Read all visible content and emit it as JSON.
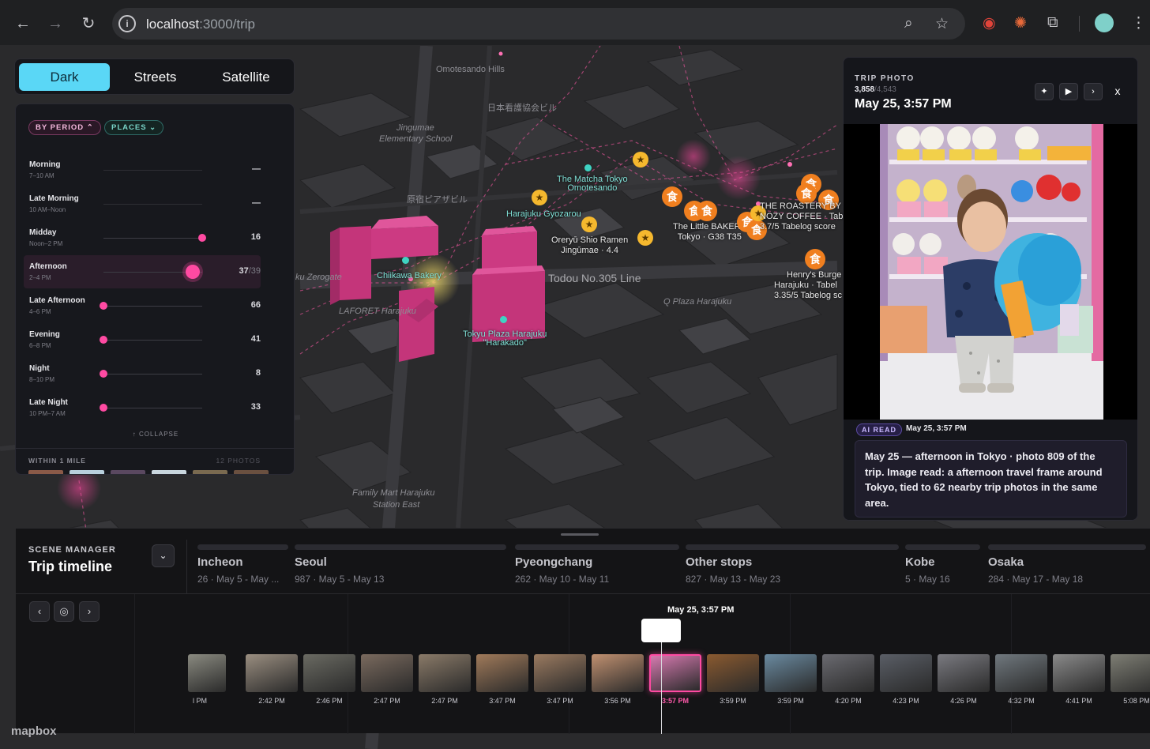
{
  "browser": {
    "url_host": "localhost",
    "url_path": ":3000/trip"
  },
  "map_style": {
    "options": [
      "Dark",
      "Streets",
      "Satellite"
    ],
    "active": "Dark"
  },
  "map_labels": {
    "omotesando_hills": "Omotesando Hills",
    "nihon_kango": "日本看護協会ビル",
    "jingumae_school_1": "Jingumae",
    "jingumae_school_2": "Elementary School",
    "harajuku_piazza": "原宿ピアザビル",
    "zerogate": "ku Zerogate",
    "laforet": "LAFORET Harajuku",
    "todou_line": "Todou No.305 Line",
    "q_plaza": "Q Plaza Harajuku",
    "family_mart_1": "Family Mart Harajuku",
    "family_mart_2": "Station East"
  },
  "pois": {
    "matcha": [
      "The Matcha Tokyo",
      "Omotesando"
    ],
    "gyozarou": "Harajuku Gyozarou",
    "chiikawa": "Chiikawa Bakery",
    "tokyu": [
      "Tokyu Plaza Harajuku",
      "\"Harakado\""
    ],
    "oreryu": [
      "Oreryū Shio Ramen",
      "Jingūmae · 4.4"
    ],
    "little_bakery": [
      "The Little BAKERY",
      "Tokyo · G38 T35"
    ],
    "roastery": [
      "THE ROASTERY BY",
      "NOZY COFFEE · Tabel",
      "3.7/5 Tabelog score"
    ],
    "henrys": [
      "Henry's Burge",
      "Harajuku · Tabel",
      "3.35/5 Tabelog sc"
    ]
  },
  "food_glyph": "食",
  "star_glyph": "★",
  "period_panel": {
    "chip_period": "BY PERIOD ⌃",
    "chip_places": "PLACES ⌄",
    "rows": [
      {
        "name": "Morning",
        "time": "7–10 AM",
        "count": "—",
        "level": null
      },
      {
        "name": "Late Morning",
        "time": "10 AM–Noon",
        "count": "—",
        "level": null
      },
      {
        "name": "Midday",
        "time": "Noon–2 PM",
        "count": "16",
        "level": 1.0
      },
      {
        "name": "Afternoon",
        "time": "2–4 PM",
        "count": "37",
        "of": "/39",
        "level": 0.9,
        "selected": true
      },
      {
        "name": "Late Afternoon",
        "time": "4–6 PM",
        "count": "66",
        "level": 0.0
      },
      {
        "name": "Evening",
        "time": "6–8 PM",
        "count": "41",
        "level": 0.0
      },
      {
        "name": "Night",
        "time": "8–10 PM",
        "count": "8",
        "level": 0.0
      },
      {
        "name": "Late Night",
        "time": "10 PM–7 AM",
        "count": "33",
        "level": 0.0
      }
    ],
    "collapse": "↑ COLLAPSE",
    "within": "WITHIN 1 MILE",
    "photos": "12 PHOTOS"
  },
  "trip_photo": {
    "label": "TRIP PHOTO",
    "index": "3,858",
    "total": "/4,543",
    "date": "May 25, 3:57 PM",
    "ai_badge": "AI READ",
    "ai_date": "May 25, 3:57 PM",
    "ai_text": "May 25 — afternoon in Tokyo · photo 809 of the trip. Image read: a afternoon travel frame around Tokyo, tied to 62 nearby trip photos in the same area."
  },
  "timeline": {
    "label": "SCENE MANAGER",
    "title": "Trip timeline",
    "cursor_label": "May 25, 3:57 PM",
    "cities": [
      {
        "name": "Incheon",
        "detail": "26 · May 5 - May ..."
      },
      {
        "name": "Seoul",
        "detail": "987 · May 5 - May 13"
      },
      {
        "name": "Pyeongchang",
        "detail": "262 · May 10 - May 11"
      },
      {
        "name": "Other stops",
        "detail": "827 · May 13 - May 23"
      },
      {
        "name": "Kobe",
        "detail": "5 · May 16"
      },
      {
        "name": "Osaka",
        "detail": "284 · May 17 - May 18"
      }
    ],
    "thumbs": [
      "l PM",
      "2:42 PM",
      "2:46 PM",
      "2:47 PM",
      "2:47 PM",
      "3:47 PM",
      "3:47 PM",
      "3:56 PM",
      "3:57 PM",
      "3:59 PM",
      "3:59 PM",
      "4:20 PM",
      "4:23 PM",
      "4:26 PM",
      "4:32 PM",
      "4:41 PM",
      "5:08 PM"
    ],
    "selected_thumb": 8
  },
  "attribution": "mapbox",
  "colors": {
    "accent": "#5ad7f6",
    "pink": "#ff4aa2",
    "food": "#f07f1f",
    "star": "#f5b82e"
  }
}
